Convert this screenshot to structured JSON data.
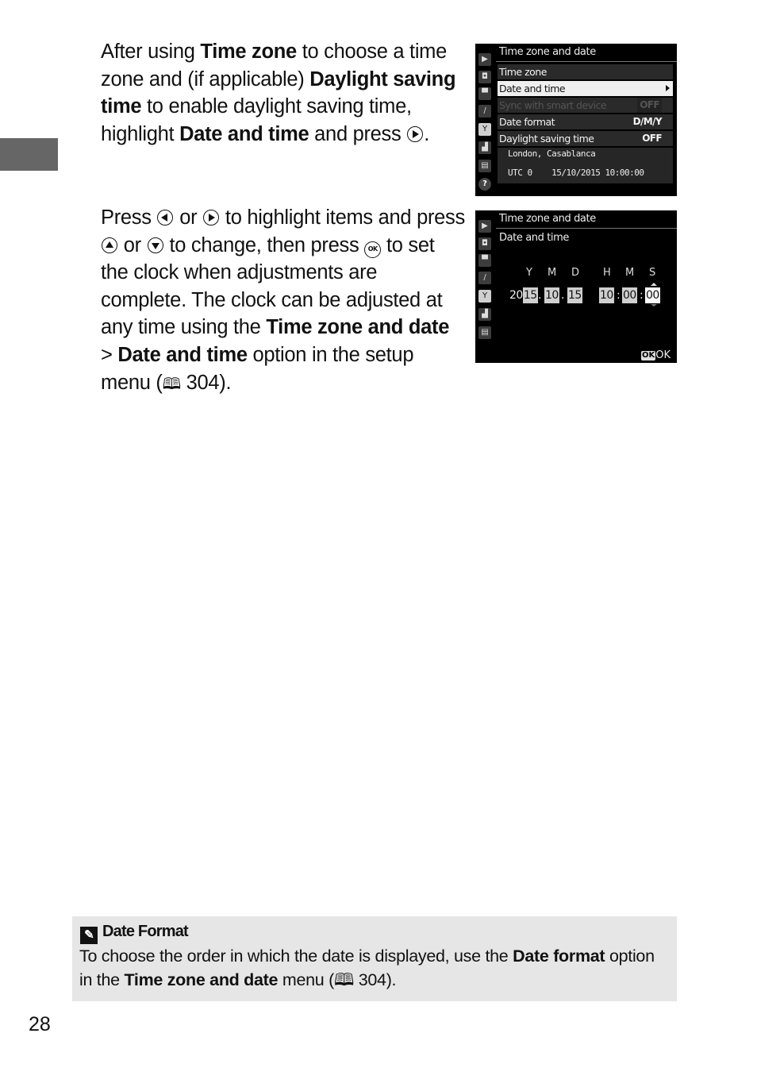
{
  "page": {
    "number": "28",
    "paragraph1": {
      "t1": "After using ",
      "b1": "Time zone",
      "t2": " to choose a time zone and (if applicable) ",
      "b2": "Daylight saving time",
      "t3": " to enable daylight saving time, highlight ",
      "b3": "Date and time",
      "t4": " and press ",
      "icon": "multi-selector-right",
      "t5": "."
    },
    "paragraph2": {
      "t1": "Press ",
      "icon1": "multi-selector-left",
      "t2": " or ",
      "icon2": "multi-selector-right",
      "t3": " to highlight items and press ",
      "icon3": "multi-selector-up",
      "t4": " or ",
      "icon4": "multi-selector-down",
      "t5": " to change, then press ",
      "icon5": "ok-button",
      "ok_glyph": "OK",
      "t6": " to set the clock when adjustments are complete.  The clock can be adjusted at any time using the ",
      "b1": "Time zone and date",
      "t7": " > ",
      "b2": "Date and time",
      "t8": " option in the setup menu (",
      "book_glyph": "🕮",
      "t9": " 304)."
    },
    "note": {
      "icon": "pencil-icon",
      "pencil_glyph": "✎",
      "title": "Date Format",
      "t1": "To choose the order in which the date is displayed, use the ",
      "b1": "Date format",
      "t2": " option in the ",
      "b2": "Time zone and date",
      "t3": " menu (",
      "book_glyph": "🕮",
      "t4": " 304)."
    }
  },
  "screen1": {
    "title": "Time zone and date",
    "sidebar_icons": [
      "playback-icon",
      "camera-icon",
      "movie-icon",
      "pencil-icon",
      "wrench-icon",
      "retouch-icon",
      "my-menu-icon",
      "help-icon"
    ],
    "sidebar_glyphs": [
      "▶",
      "◘",
      "▀",
      "/",
      "Y",
      "▟",
      "▤",
      "?"
    ],
    "active_sidebar": "wrench-icon",
    "rows": [
      {
        "label": "Time zone",
        "value": ""
      },
      {
        "label": "Date and time",
        "value": "",
        "selected": true
      },
      {
        "label": "Sync with smart device",
        "value": "OFF",
        "disabled": true
      },
      {
        "label": "Date format",
        "value": "D/M/Y"
      },
      {
        "label": "Daylight saving time",
        "value": "OFF"
      }
    ],
    "info": {
      "city": "London, Casablanca",
      "utc": "UTC  0",
      "datetime": "15/10/2015 10:00:00"
    }
  },
  "screen2": {
    "title": "Time zone and date",
    "subtitle": "Date and time",
    "labels": {
      "y": "Y",
      "mo": "M",
      "d": "D",
      "h": "H",
      "mi": "M",
      "s": "S"
    },
    "year_prefix": "20",
    "year": "15",
    "month": "10",
    "day": "15",
    "hour": "10",
    "minute": "00",
    "second": "00",
    "date_sep": ".",
    "time_sep": ":",
    "active_field": "second",
    "ok_badge": "OK",
    "ok_label": "OK"
  }
}
